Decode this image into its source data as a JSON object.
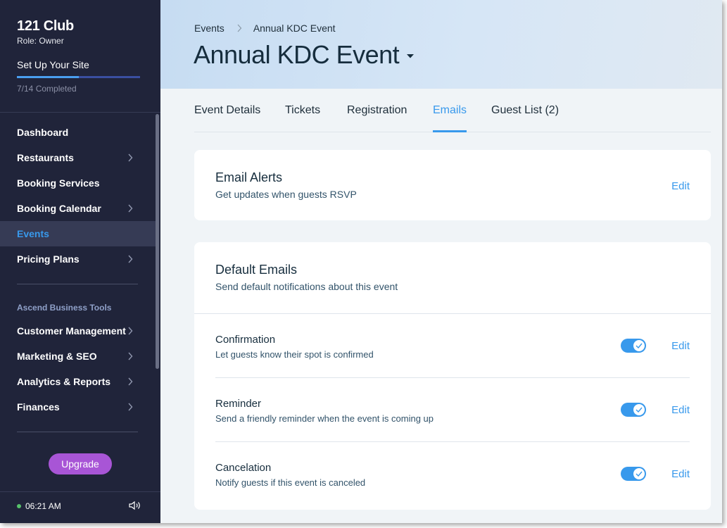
{
  "sidebar": {
    "site_name": "121 Club",
    "role": "Role: Owner",
    "setup_title": "Set Up Your Site",
    "setup_progress": 0.5,
    "setup_count": "7/14 Completed",
    "nav_items": [
      {
        "label": "Dashboard",
        "chevron": false
      },
      {
        "label": "Restaurants",
        "chevron": true
      },
      {
        "label": "Booking Services",
        "chevron": false
      },
      {
        "label": "Booking Calendar",
        "chevron": true
      },
      {
        "label": "Events",
        "chevron": false,
        "active": true
      },
      {
        "label": "Pricing Plans",
        "chevron": true
      }
    ],
    "group_label": "Ascend Business Tools",
    "group_items": [
      {
        "label": "Customer Management",
        "chevron": true
      },
      {
        "label": "Marketing & SEO",
        "chevron": true
      },
      {
        "label": "Analytics & Reports",
        "chevron": true
      },
      {
        "label": "Finances",
        "chevron": true
      }
    ],
    "upgrade_label": "Upgrade",
    "time": "06:21 AM",
    "icons": {
      "chevron": "chevron-right-icon",
      "speaker": "speaker-icon",
      "status": "status-dot"
    }
  },
  "header": {
    "breadcrumb": [
      "Events",
      "Annual KDC Event"
    ],
    "title": "Annual KDC Event"
  },
  "tabs": [
    {
      "label": "Event Details"
    },
    {
      "label": "Tickets"
    },
    {
      "label": "Registration"
    },
    {
      "label": "Emails",
      "active": true
    },
    {
      "label": "Guest List (2)"
    }
  ],
  "email_alerts": {
    "title": "Email Alerts",
    "subtitle": "Get updates when guests RSVP",
    "edit_label": "Edit"
  },
  "default_emails": {
    "title": "Default Emails",
    "subtitle": "Send default notifications about this event",
    "rows": [
      {
        "title": "Confirmation",
        "subtitle": "Let guests know their spot is confirmed",
        "enabled": true,
        "edit_label": "Edit"
      },
      {
        "title": "Reminder",
        "subtitle": "Send a friendly reminder when the event is coming up",
        "enabled": true,
        "edit_label": "Edit"
      },
      {
        "title": "Cancelation",
        "subtitle": "Notify guests if this event is canceled",
        "enabled": true,
        "edit_label": "Edit"
      }
    ]
  },
  "colors": {
    "sidebar_bg": "#20243a",
    "accent": "#3899ec",
    "upgrade": "#a855d6",
    "active_nav_bg": "#363b55"
  }
}
